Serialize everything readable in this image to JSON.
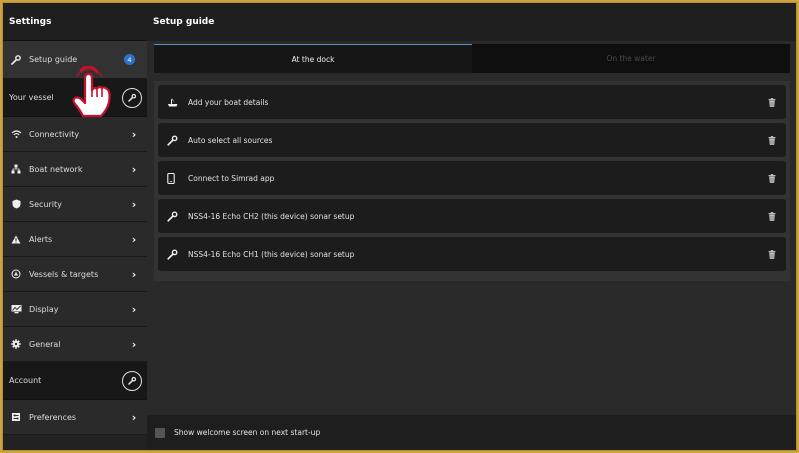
{
  "sidebar": {
    "title": "Settings",
    "setup_guide": {
      "label": "Setup guide",
      "badge": "4"
    },
    "your_vessel": {
      "label": "Your vessel"
    },
    "items": [
      {
        "label": "Connectivity",
        "icon": "wifi-icon"
      },
      {
        "label": "Boat network",
        "icon": "network-icon"
      },
      {
        "label": "Security",
        "icon": "shield-icon"
      },
      {
        "label": "Alerts",
        "icon": "alert-icon"
      },
      {
        "label": "Vessels & targets",
        "icon": "target-icon"
      },
      {
        "label": "Display",
        "icon": "display-icon"
      },
      {
        "label": "General",
        "icon": "gear-icon"
      }
    ],
    "account": {
      "label": "Account"
    },
    "preferences": {
      "label": "Preferences",
      "icon": "preferences-icon"
    }
  },
  "main": {
    "title": "Setup guide",
    "tabs": [
      {
        "label": "At the dock",
        "active": true
      },
      {
        "label": "On the water",
        "active": false
      }
    ],
    "steps": [
      {
        "label": "Add your boat details",
        "icon": "boat-icon"
      },
      {
        "label": "Auto select all sources",
        "icon": "wrench-icon"
      },
      {
        "label": "Connect to Simrad app",
        "icon": "phone-icon"
      },
      {
        "label": "NSS4-16 Echo CH2 (this device) sonar setup",
        "icon": "wrench-icon"
      },
      {
        "label": "NSS4-16 Echo CH1 (this device) sonar setup",
        "icon": "wrench-icon"
      }
    ],
    "footer": {
      "checkbox_label": "Show welcome screen on next start-up",
      "checked": false
    }
  },
  "colors": {
    "accent": "#2f73c7",
    "frame": "#c9a441",
    "pointer": "#c8102e"
  }
}
